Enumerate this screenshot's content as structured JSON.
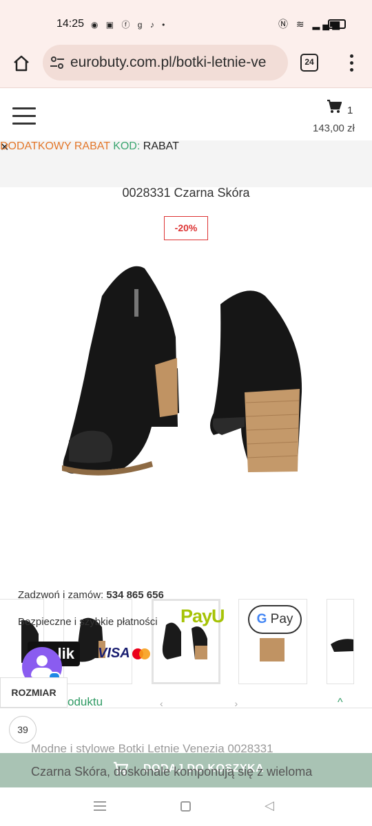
{
  "status": {
    "time": "14:25",
    "left_icons": [
      "messenger-icon",
      "temu-icon",
      "facebook-icon",
      "g-icon",
      "tiktok-icon",
      "dot-icon"
    ],
    "right_icons": [
      "nfc-icon",
      "wifi-icon",
      "signal-icon",
      "battery-icon"
    ]
  },
  "browser": {
    "url": "eurobuty.com.pl/botki-letnie-ve",
    "tab_count": "24"
  },
  "header": {
    "cart_count": "1",
    "cart_total": "143,00 zł"
  },
  "promo": {
    "label": "DODATKOWY RABAT",
    "code_label": "KOD:",
    "code": "RABAT",
    "accent": "#e3772a",
    "secondary": "#3aa56f"
  },
  "product": {
    "title": "0028331 Czarna Skóra",
    "discount": "-20%"
  },
  "info": {
    "call_text": "Zadzwoń i zamów:",
    "phone": "534 865 656",
    "payments_text": "Bezpieczne i szybkie płatności",
    "payment_logos": {
      "payu": "PayU",
      "gpay_g": "G",
      "gpay_text": "Pay",
      "blik": "lik",
      "visa": "VISA"
    }
  },
  "sections": {
    "rozmiar_tab": "ROZMIAR",
    "produktu_partial": "oduktu",
    "nav_arrows": "‹ ›",
    "collapse": "^"
  },
  "size": {
    "selected": "39"
  },
  "description": {
    "line1": "Modne i stylowe Botki Letnie Venezia 0028331",
    "line2": "Czarna Skóra, doskonale komponują się z wieloma"
  },
  "cta": {
    "add_to_cart": "DODAJ DO KOSZYKA",
    "color": "#a9c3b4"
  }
}
